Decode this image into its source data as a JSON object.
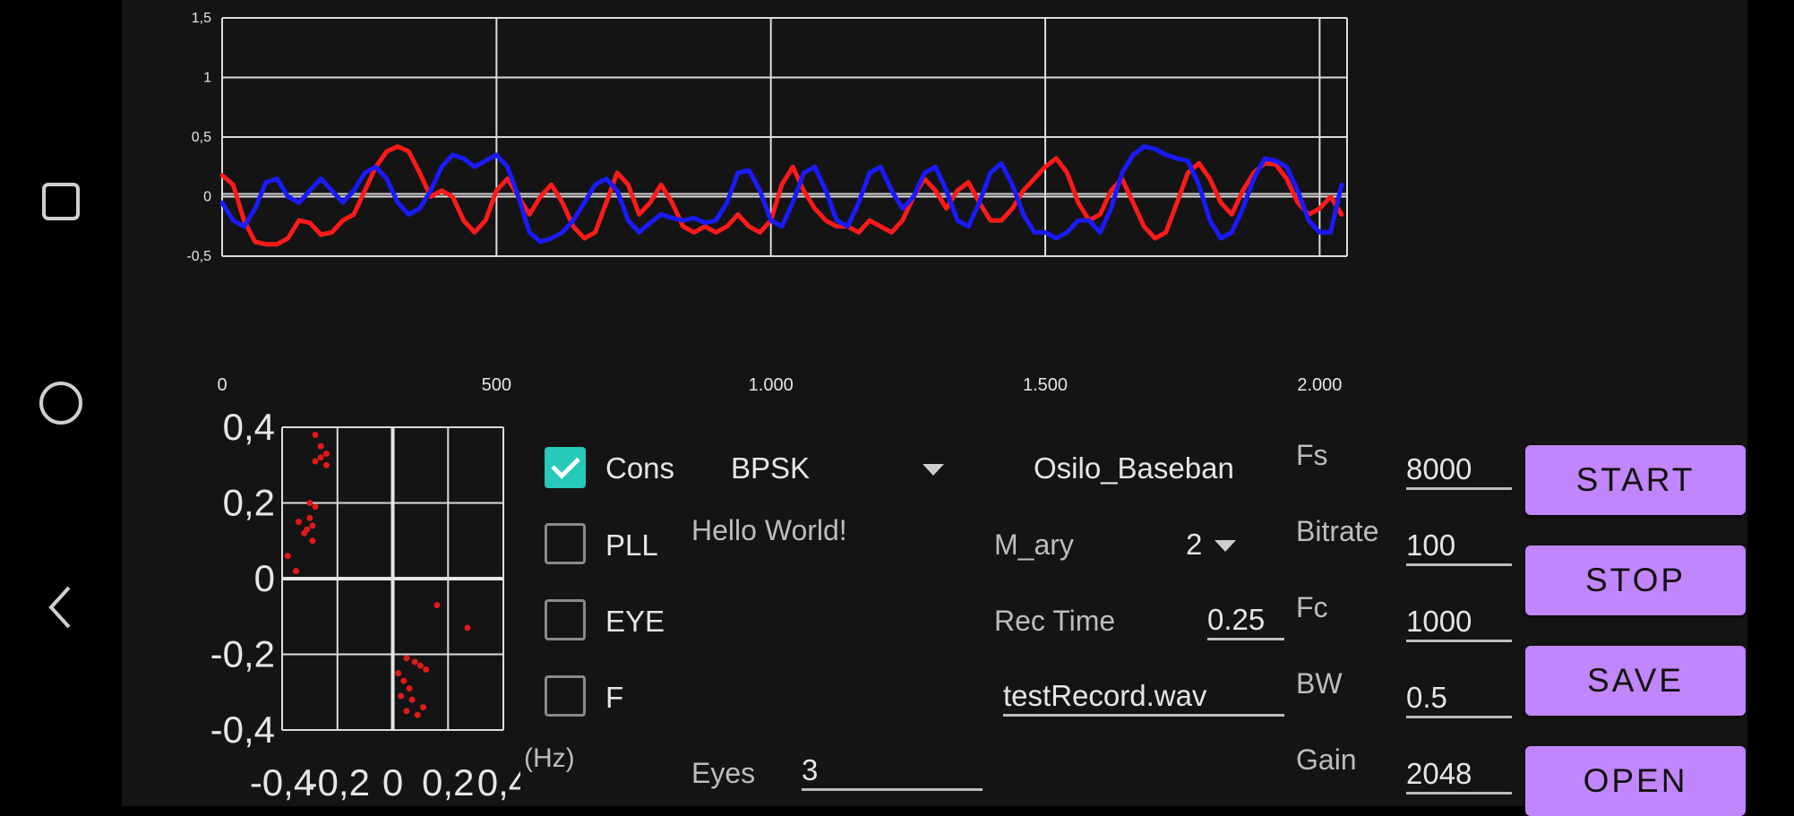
{
  "colors": {
    "background": "#141414",
    "grid": "#dcdcdc",
    "series_red": "#ff1a1a",
    "series_blue": "#1a1aff",
    "accent_teal": "#27c9b8",
    "button_purple": "#c186fb"
  },
  "nav": {
    "recents_icon": "square-icon",
    "home_icon": "circle-icon",
    "back_icon": "back-chevron-icon"
  },
  "chart_data": [
    {
      "type": "line",
      "title": "",
      "xlabel": "",
      "ylabel": "",
      "xlim": [
        0,
        2050
      ],
      "ylim": [
        -0.5,
        1.5
      ],
      "x_ticks": [
        0,
        500,
        1000,
        1500,
        2000
      ],
      "x_tick_labels": [
        "0",
        "500",
        "1.000",
        "1.500",
        "2.000"
      ],
      "y_ticks": [
        -0.5,
        0,
        0.5,
        1,
        1.5
      ],
      "y_tick_labels": [
        "-0,5",
        "0",
        "0,5",
        "1",
        "1,5"
      ],
      "grid": true,
      "legend": "none",
      "series": [
        {
          "color": "#ff1a1a",
          "x": [
            0,
            20,
            40,
            60,
            80,
            100,
            120,
            140,
            160,
            180,
            200,
            220,
            240,
            260,
            280,
            300,
            320,
            340,
            360,
            380,
            400,
            420,
            440,
            460,
            480,
            500,
            520,
            540,
            560,
            580,
            600,
            620,
            640,
            660,
            680,
            700,
            720,
            740,
            760,
            780,
            800,
            820,
            840,
            860,
            880,
            900,
            920,
            940,
            960,
            980,
            1000,
            1020,
            1040,
            1060,
            1080,
            1100,
            1120,
            1140,
            1160,
            1180,
            1200,
            1220,
            1240,
            1260,
            1280,
            1300,
            1320,
            1340,
            1360,
            1380,
            1400,
            1420,
            1440,
            1460,
            1480,
            1500,
            1520,
            1540,
            1560,
            1580,
            1600,
            1620,
            1640,
            1660,
            1680,
            1700,
            1720,
            1740,
            1760,
            1780,
            1800,
            1820,
            1840,
            1860,
            1880,
            1900,
            1920,
            1940,
            1960,
            1980,
            2000,
            2020,
            2040
          ],
          "values": [
            0.18,
            0.1,
            -0.2,
            -0.38,
            -0.4,
            -0.4,
            -0.35,
            -0.2,
            -0.22,
            -0.32,
            -0.3,
            -0.2,
            -0.15,
            0.05,
            0.25,
            0.38,
            0.42,
            0.38,
            0.2,
            0.0,
            0.05,
            0.0,
            -0.2,
            -0.3,
            -0.2,
            0.05,
            0.15,
            0.0,
            -0.15,
            0.0,
            0.1,
            -0.05,
            -0.25,
            -0.35,
            -0.3,
            -0.05,
            0.2,
            0.1,
            -0.15,
            -0.05,
            0.1,
            -0.05,
            -0.25,
            -0.3,
            -0.25,
            -0.3,
            -0.25,
            -0.15,
            -0.25,
            -0.3,
            -0.2,
            0.1,
            0.25,
            0.05,
            -0.1,
            -0.2,
            -0.25,
            -0.25,
            -0.3,
            -0.2,
            -0.25,
            -0.3,
            -0.2,
            0.0,
            0.15,
            0.05,
            -0.1,
            0.05,
            0.12,
            -0.05,
            -0.2,
            -0.2,
            -0.1,
            0.05,
            0.15,
            0.25,
            0.32,
            0.2,
            -0.05,
            -0.2,
            -0.15,
            0.05,
            0.15,
            -0.05,
            -0.25,
            -0.35,
            -0.3,
            -0.05,
            0.2,
            0.28,
            0.15,
            -0.05,
            -0.15,
            0.05,
            0.2,
            0.28,
            0.27,
            0.15,
            -0.05,
            -0.15,
            -0.1,
            0.0,
            -0.15
          ]
        },
        {
          "color": "#1a1aff",
          "x": [
            0,
            20,
            40,
            60,
            80,
            100,
            120,
            140,
            160,
            180,
            200,
            220,
            240,
            260,
            280,
            300,
            320,
            340,
            360,
            380,
            400,
            420,
            440,
            460,
            480,
            500,
            520,
            540,
            560,
            580,
            600,
            620,
            640,
            660,
            680,
            700,
            720,
            740,
            760,
            780,
            800,
            820,
            840,
            860,
            880,
            900,
            920,
            940,
            960,
            980,
            1000,
            1020,
            1040,
            1060,
            1080,
            1100,
            1120,
            1140,
            1160,
            1180,
            1200,
            1220,
            1240,
            1260,
            1280,
            1300,
            1320,
            1340,
            1360,
            1380,
            1400,
            1420,
            1440,
            1460,
            1480,
            1500,
            1520,
            1540,
            1560,
            1580,
            1600,
            1620,
            1640,
            1660,
            1680,
            1700,
            1720,
            1740,
            1760,
            1780,
            1800,
            1820,
            1840,
            1860,
            1880,
            1900,
            1920,
            1940,
            1960,
            1980,
            2000,
            2020,
            2040
          ],
          "values": [
            -0.05,
            -0.2,
            -0.25,
            -0.1,
            0.12,
            0.15,
            0.0,
            -0.05,
            0.05,
            0.15,
            0.05,
            -0.05,
            0.05,
            0.2,
            0.25,
            0.15,
            -0.05,
            -0.15,
            -0.1,
            0.05,
            0.25,
            0.35,
            0.32,
            0.25,
            0.3,
            0.35,
            0.25,
            0.0,
            -0.3,
            -0.38,
            -0.35,
            -0.3,
            -0.2,
            -0.05,
            0.1,
            0.15,
            0.05,
            -0.2,
            -0.3,
            -0.22,
            -0.15,
            -0.18,
            -0.2,
            -0.18,
            -0.22,
            -0.2,
            -0.05,
            0.2,
            0.22,
            0.05,
            -0.2,
            -0.25,
            -0.05,
            0.2,
            0.25,
            0.05,
            -0.2,
            -0.25,
            -0.05,
            0.2,
            0.25,
            0.05,
            -0.1,
            0.0,
            0.2,
            0.25,
            0.05,
            -0.2,
            -0.25,
            -0.05,
            0.2,
            0.28,
            0.1,
            -0.15,
            -0.3,
            -0.3,
            -0.35,
            -0.3,
            -0.2,
            -0.2,
            -0.3,
            -0.1,
            0.2,
            0.35,
            0.42,
            0.4,
            0.35,
            0.32,
            0.3,
            0.1,
            -0.2,
            -0.35,
            -0.3,
            -0.1,
            0.15,
            0.32,
            0.3,
            0.25,
            0.05,
            -0.2,
            -0.3,
            -0.3,
            0.1
          ]
        }
      ]
    },
    {
      "type": "scatter",
      "title": "",
      "xlabel": "",
      "ylabel": "",
      "xlim": [
        -0.4,
        0.4
      ],
      "ylim": [
        -0.4,
        0.4
      ],
      "x_ticks": [
        -0.4,
        -0.2,
        0,
        0.2,
        0.4
      ],
      "x_tick_labels": [
        "-0,4",
        "-0,2",
        "0",
        "0,2",
        "0,4"
      ],
      "y_ticks": [
        -0.4,
        -0.2,
        0,
        0.2,
        0.4
      ],
      "y_tick_labels": [
        "-0,4",
        "-0,2",
        "0",
        "0,2",
        "0,4"
      ],
      "grid": true,
      "legend": "none",
      "series": [
        {
          "color": "#e01a1a",
          "points": [
            [
              -0.28,
              0.38
            ],
            [
              -0.26,
              0.35
            ],
            [
              -0.24,
              0.33
            ],
            [
              -0.26,
              0.32
            ],
            [
              -0.24,
              0.3
            ],
            [
              -0.28,
              0.31
            ],
            [
              -0.3,
              0.2
            ],
            [
              -0.28,
              0.19
            ],
            [
              -0.3,
              0.16
            ],
            [
              -0.29,
              0.14
            ],
            [
              -0.31,
              0.13
            ],
            [
              -0.32,
              0.12
            ],
            [
              -0.29,
              0.1
            ],
            [
              -0.34,
              0.15
            ],
            [
              -0.38,
              0.06
            ],
            [
              -0.35,
              0.02
            ],
            [
              0.16,
              -0.07
            ],
            [
              0.27,
              -0.13
            ],
            [
              0.05,
              -0.21
            ],
            [
              0.08,
              -0.22
            ],
            [
              0.1,
              -0.23
            ],
            [
              0.12,
              -0.24
            ],
            [
              0.04,
              -0.27
            ],
            [
              0.03,
              -0.31
            ],
            [
              0.07,
              -0.32
            ],
            [
              0.05,
              -0.35
            ],
            [
              0.09,
              -0.36
            ],
            [
              0.11,
              -0.34
            ],
            [
              0.02,
              -0.25
            ],
            [
              0.06,
              -0.29
            ]
          ]
        }
      ]
    }
  ],
  "controls": {
    "cons": {
      "label": "Cons",
      "checked": true
    },
    "pll": {
      "label": "PLL",
      "checked": false
    },
    "eye": {
      "label": "EYE",
      "checked": false
    },
    "f": {
      "label": "F",
      "checked": false
    },
    "modulation": "BPSK",
    "display_mode": "Osilo_Baseban",
    "message": "Hello World!",
    "hz_label": "(Hz)",
    "eyes_label": "Eyes",
    "eyes_value": "3",
    "m_ary_label": "M_ary",
    "m_ary_value": "2",
    "rec_time_label": "Rec Time",
    "rec_time_value": "0.25",
    "filename": "testRecord.wav",
    "fs_label": "Fs",
    "fs_value": "8000",
    "bitrate_label": "Bitrate",
    "bitrate_value": "100",
    "fc_label": "Fc",
    "fc_value": "1000",
    "bw_label": "BW",
    "bw_value": "0.5",
    "gain_label": "Gain",
    "gain_value": "2048"
  },
  "buttons": {
    "start": "START",
    "stop": "STOP",
    "save": "SAVE",
    "open": "OPEN"
  }
}
